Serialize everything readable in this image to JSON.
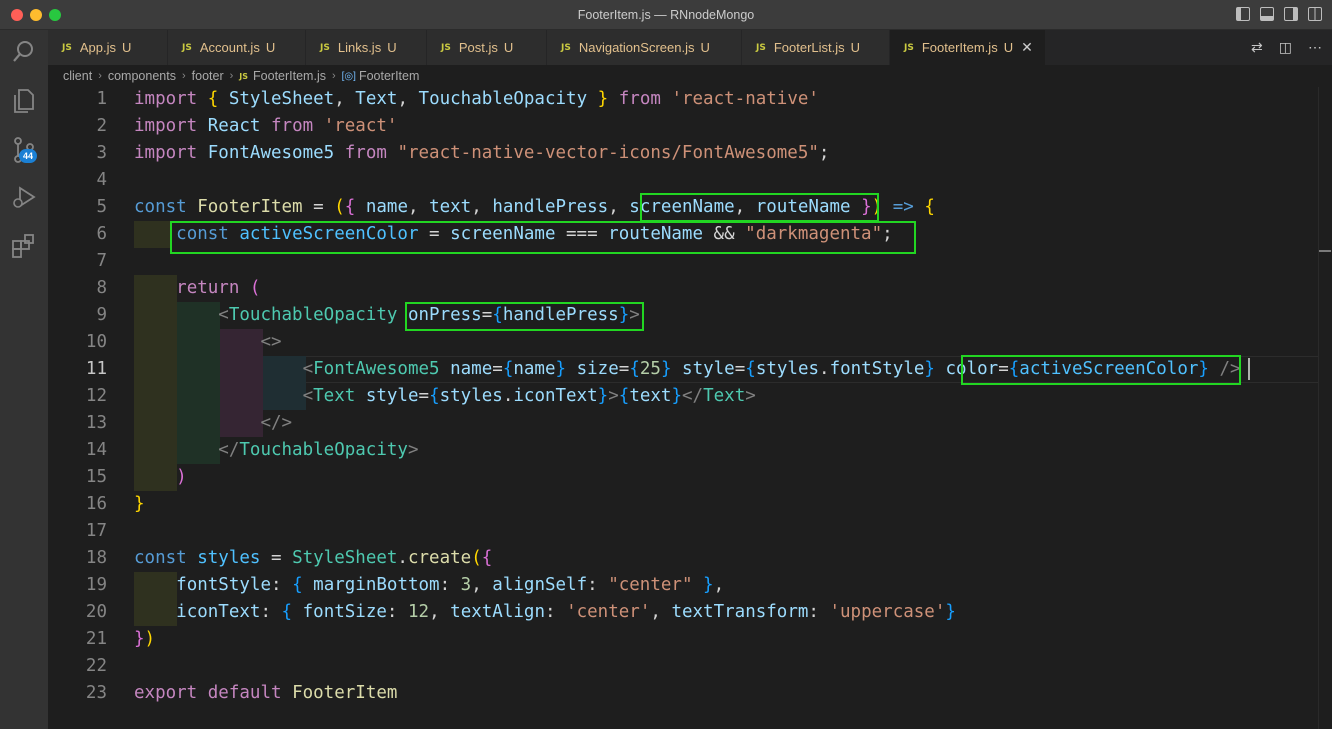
{
  "window": {
    "title": "FooterItem.js — RNnodeMongo"
  },
  "activity_bar": {
    "source_control_badge": "44",
    "icons": [
      "search-icon",
      "files-icon",
      "source-control-icon",
      "run-debug-icon",
      "extensions-icon"
    ]
  },
  "tabs": [
    {
      "label": "App.js",
      "mark": "U"
    },
    {
      "label": "Account.js",
      "mark": "U"
    },
    {
      "label": "Links.js",
      "mark": "U"
    },
    {
      "label": "Post.js",
      "mark": "U"
    },
    {
      "label": "NavigationScreen.js",
      "mark": "U"
    },
    {
      "label": "FooterList.js",
      "mark": "U"
    },
    {
      "label": "FooterItem.js",
      "mark": "U",
      "active": true
    }
  ],
  "tab_icon_text": "JS",
  "breadcrumb": {
    "parts": [
      "client",
      "components",
      "footer",
      "FooterItem.js",
      "FooterItem"
    ]
  },
  "editor": {
    "current_line": 11,
    "line_numbers": [
      "1",
      "2",
      "3",
      "4",
      "5",
      "6",
      "7",
      "8",
      "9",
      "10",
      "11",
      "12",
      "13",
      "14",
      "15",
      "16",
      "17",
      "18",
      "19",
      "20",
      "21",
      "22",
      "23"
    ],
    "lines": [
      "import { StyleSheet, Text, TouchableOpacity } from 'react-native'",
      "import React from 'react'",
      "import FontAwesome5 from \"react-native-vector-icons/FontAwesome5\";",
      "",
      "const FooterItem = ({ name, text, handlePress, screenName, routeName }) => {",
      "    const activeScreenColor = screenName === routeName && \"darkmagenta\";",
      "",
      "    return (",
      "        <TouchableOpacity onPress={handlePress}>",
      "            <>",
      "                <FontAwesome5 name={name} size={25} style={styles.fontStyle} color={activeScreenColor} />",
      "                <Text style={styles.iconText}>{text}</Text>",
      "            </>",
      "        </TouchableOpacity>",
      "    )",
      "}",
      "",
      "const styles = StyleSheet.create({",
      "    fontStyle: { marginBottom: 3, alignSelf: \"center\" },",
      "    iconText: { fontSize: 12, textAlign: 'center', textTransform: 'uppercase'}",
      "})",
      "",
      "export default FooterItem"
    ]
  },
  "highlight_color": "#22d622"
}
